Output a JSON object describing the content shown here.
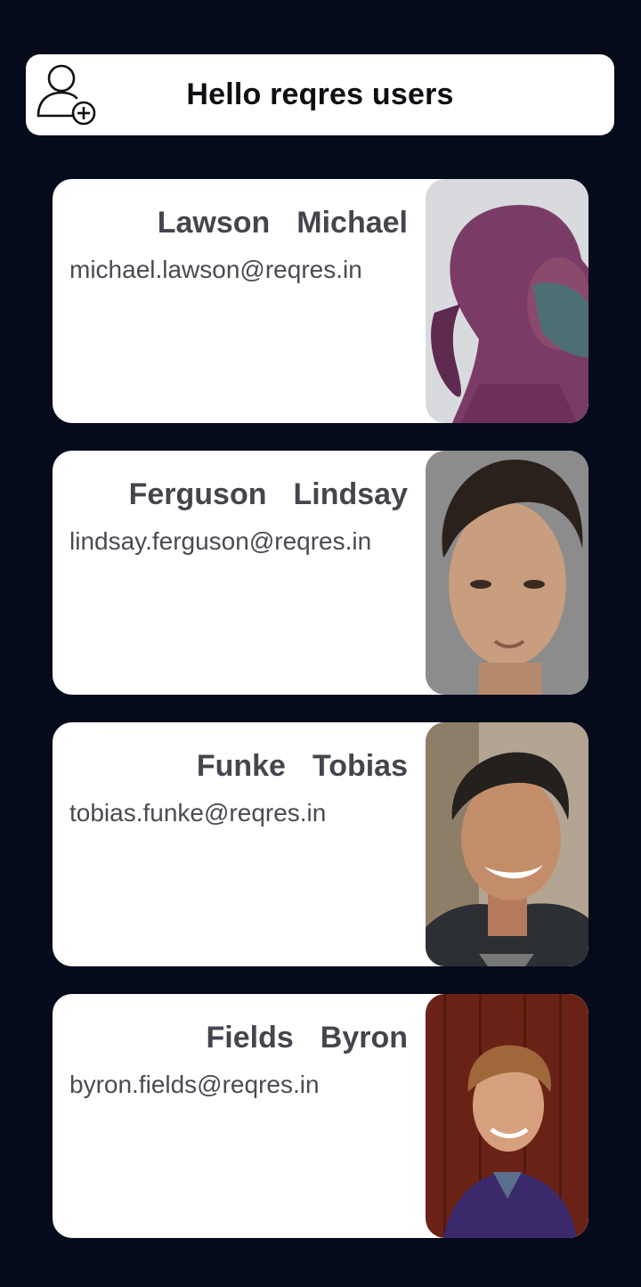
{
  "header": {
    "title": "Hello reqres users",
    "add_icon": "add-user-icon"
  },
  "users": [
    {
      "last_name": "Lawson",
      "first_name": "Michael",
      "email": "michael.lawson@reqres.in",
      "avatar_bg": "#d7d8dc",
      "avatar_tone": "#6b3a5e"
    },
    {
      "last_name": "Ferguson",
      "first_name": "Lindsay",
      "email": "lindsay.ferguson@reqres.in",
      "avatar_bg": "#8a8a8a",
      "avatar_tone": "#c9a07e"
    },
    {
      "last_name": "Funke",
      "first_name": "Tobias",
      "email": "tobias.funke@reqres.in",
      "avatar_bg": "#b8ac9a",
      "avatar_tone": "#c08a66"
    },
    {
      "last_name": "Fields",
      "first_name": "Byron",
      "email": "byron.fields@reqres.in",
      "avatar_bg": "#6e2418",
      "avatar_tone": "#d8a07e"
    }
  ]
}
